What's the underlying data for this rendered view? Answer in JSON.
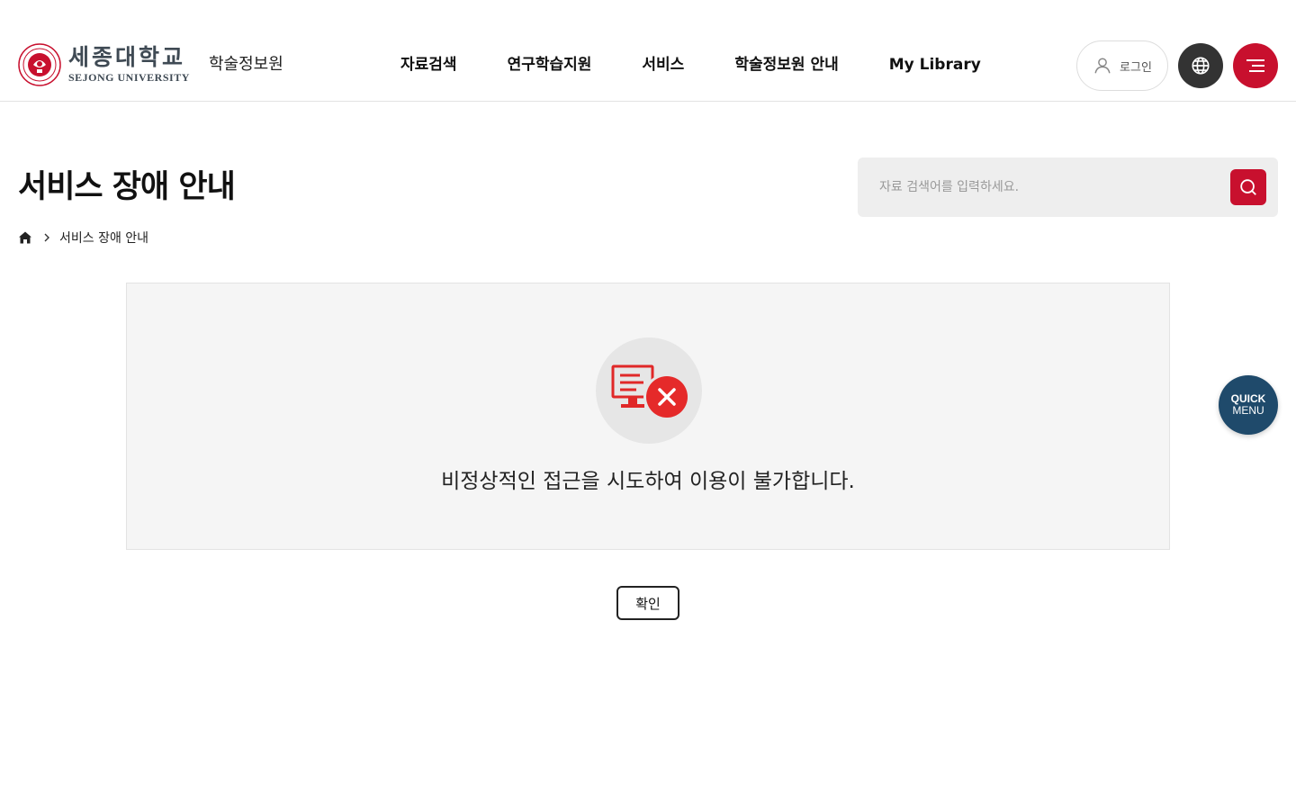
{
  "header": {
    "logo_kr": "세종대학교",
    "logo_en": "SEJONG UNIVERSITY",
    "site_name": "학술정보원",
    "nav": [
      {
        "label": "자료검색"
      },
      {
        "label": "연구학습지원"
      },
      {
        "label": "서비스"
      },
      {
        "label": "학술정보원 안내"
      },
      {
        "label": "My Library"
      }
    ],
    "login_label": "로그인",
    "globe_icon": "globe-icon",
    "menu_icon": "hamburger-menu-icon"
  },
  "page": {
    "title": "서비스 장애 안내",
    "breadcrumb": {
      "home_icon": "home-icon",
      "current": "서비스 장애 안내"
    }
  },
  "search": {
    "placeholder": "자료 검색어를 입력하세요.",
    "value": ""
  },
  "notice": {
    "icon": "system-error-icon",
    "message": "비정상적인 접근을 시도하여 이용이 불가합니다.",
    "confirm_label": "확인"
  },
  "quick_menu": {
    "line1": "QUICK",
    "line2": "MENU"
  },
  "colors": {
    "brand_red": "#c8102e",
    "dark_button": "#333333",
    "quick_menu_bg": "#1f4a6b",
    "panel_bg": "#f5f5f5",
    "search_bg": "#eeeeee"
  }
}
